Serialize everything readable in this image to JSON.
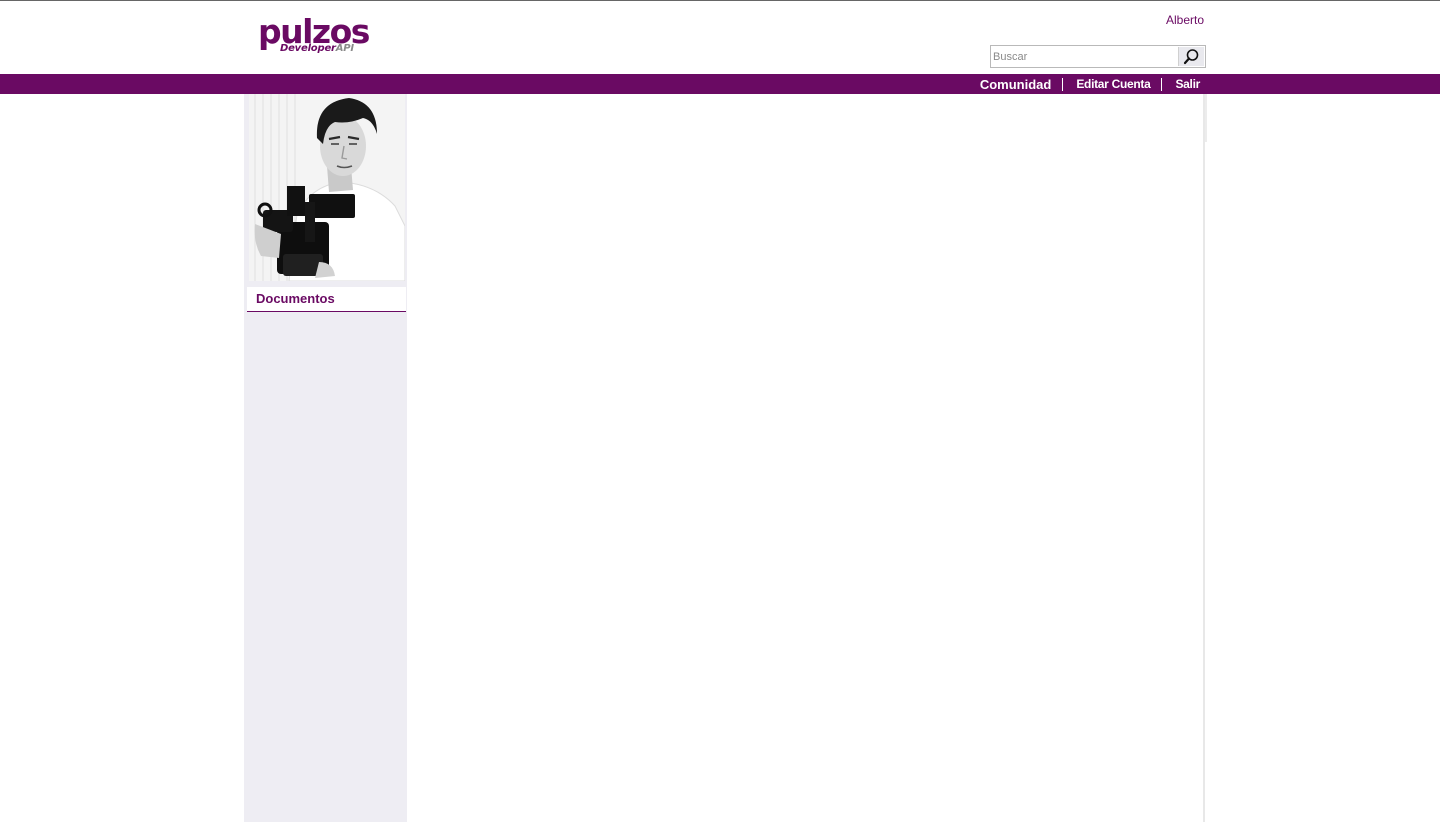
{
  "header": {
    "logo_main": "pulzos",
    "logo_sub_main": "Developer",
    "logo_sub_accent": "API",
    "user_name": "Alberto"
  },
  "search": {
    "placeholder": "Buscar",
    "value": "",
    "button_icon": "search-icon"
  },
  "nav": {
    "items": [
      {
        "label": "Comunidad"
      },
      {
        "label": "Editar Cuenta"
      },
      {
        "label": "Salir"
      }
    ]
  },
  "sidebar": {
    "avatar_icon": "profile-photo",
    "section_title": "Documentos"
  },
  "colors": {
    "brand": "#6a0a63",
    "sidebar_bg": "#eeedf3",
    "logo_api": "#8a8a8a"
  }
}
